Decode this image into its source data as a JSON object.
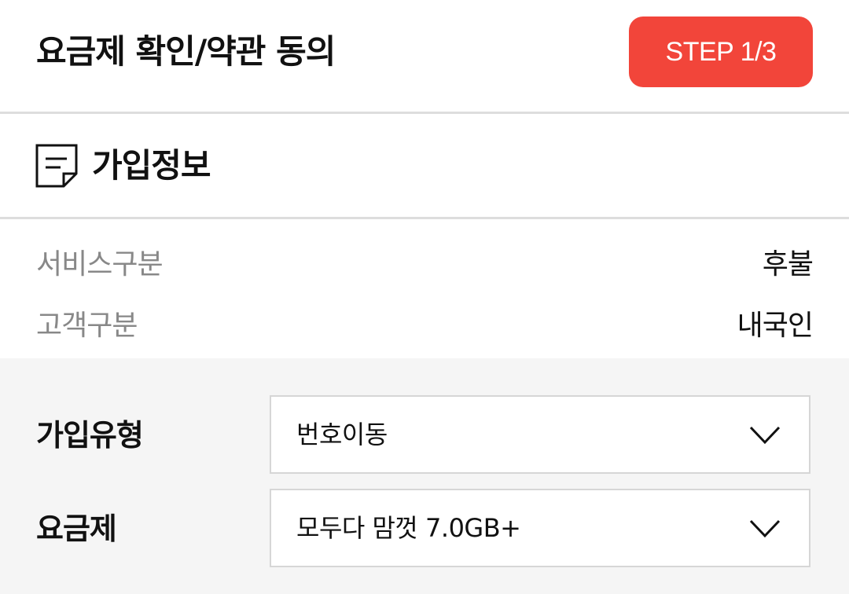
{
  "header": {
    "title": "요금제 확인/약관 동의",
    "step_label": "STEP 1/3"
  },
  "section": {
    "title": "가입정보",
    "icon": "document-icon"
  },
  "info": [
    {
      "label": "서비스구분",
      "value": "후불"
    },
    {
      "label": "고객구분",
      "value": "내국인"
    }
  ],
  "form": {
    "join_type": {
      "label": "가입유형",
      "value": "번호이동"
    },
    "plan": {
      "label": "요금제",
      "value": "모두다 맘껏 7.0GB+"
    }
  },
  "colors": {
    "accent": "#f2453a",
    "form_background": "#f5f5f5",
    "muted_text": "#888888",
    "divider": "#dddddd"
  }
}
